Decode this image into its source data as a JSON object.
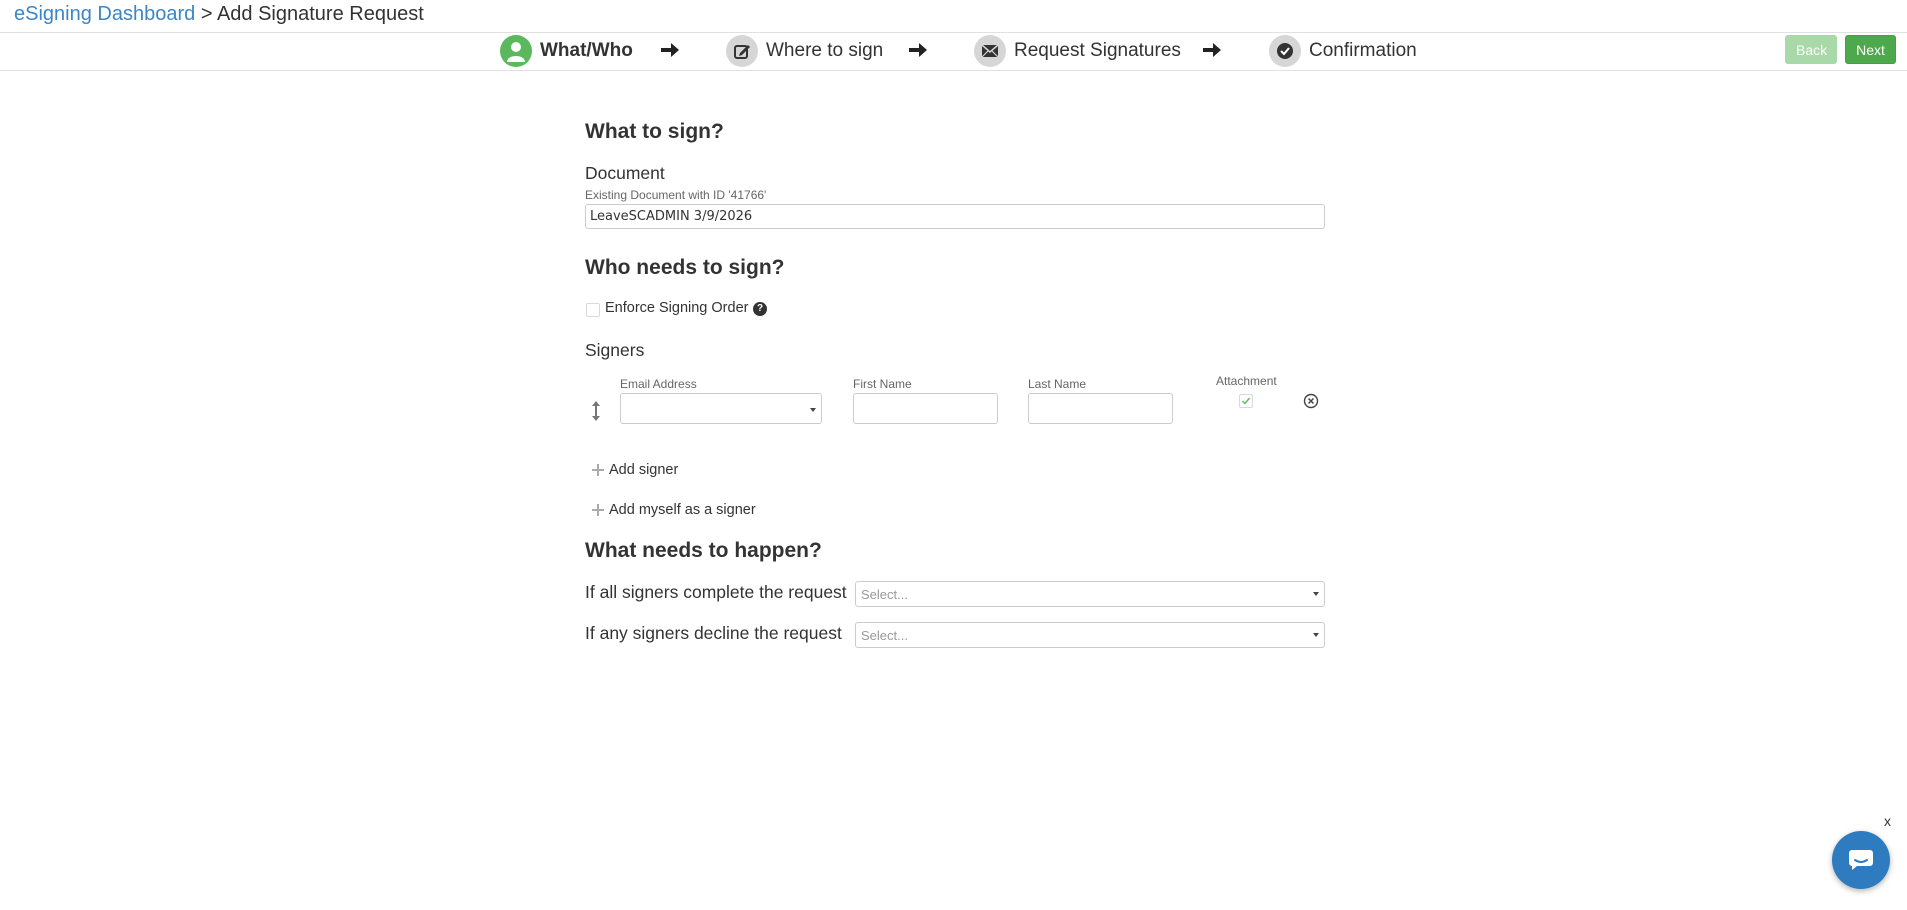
{
  "breadcrumb": {
    "link": "eSigning Dashboard",
    "separator": ">",
    "current": "Add Signature Request"
  },
  "wizard": {
    "steps": [
      {
        "label": "What/Who",
        "icon": "user-icon",
        "active": true
      },
      {
        "label": "Where to sign",
        "icon": "edit-icon",
        "active": false
      },
      {
        "label": "Request Signatures",
        "icon": "envelope-icon",
        "active": false
      },
      {
        "label": "Confirmation",
        "icon": "check-circle-icon",
        "active": false
      }
    ],
    "back_label": "Back",
    "next_label": "Next",
    "colors": {
      "active": "#5cb85c",
      "inactive": "#d6d6d6",
      "next": "#4ea84c",
      "back_disabled": "#a9d9a8"
    }
  },
  "what": {
    "heading": "What to sign?",
    "document_label": "Document",
    "document_hint": "Existing Document with ID '41766'",
    "document_value": "LeaveSCADMIN 3/9/2026"
  },
  "who": {
    "heading": "Who needs to sign?",
    "enforce_order_label": "Enforce Signing Order",
    "signers_label": "Signers",
    "columns": {
      "email": "Email Address",
      "first_name": "First Name",
      "last_name": "Last Name",
      "attachment": "Attachment"
    },
    "signer_row": {
      "email": "",
      "first_name": "",
      "last_name": "",
      "attachment": true
    },
    "add_signer": "Add signer",
    "add_myself": "Add myself as a signer"
  },
  "happen": {
    "heading": "What needs to happen?",
    "complete_label": "If all signers complete the request",
    "complete_placeholder": "Select...",
    "decline_label": "If any signers decline the request",
    "decline_placeholder": "Select..."
  },
  "chat": {
    "close_label": "x"
  }
}
